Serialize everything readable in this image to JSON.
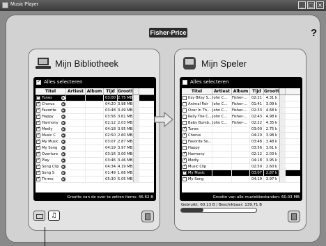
{
  "window": {
    "title": "Music Player",
    "buttons": [
      "_",
      "□",
      "×"
    ]
  },
  "logo": "Fisher-Price",
  "help": "?",
  "library": {
    "title": "Mijn Bibliotheek",
    "select_all": "Alles selecteren",
    "select_all_checked": true,
    "columns": [
      "Titel",
      "Artiest",
      "Album",
      "Tijd",
      "Grootte"
    ],
    "rows": [
      {
        "title": "Tunes",
        "artist": "",
        "album": "",
        "time": "03:00",
        "size": "2.75 MB",
        "checked": true,
        "selected": true
      },
      {
        "title": "Chorus",
        "artist": "",
        "album": "",
        "time": "04:20",
        "size": "3.98 MB",
        "checked": true
      },
      {
        "title": "Favorite",
        "artist": "",
        "album": "",
        "time": "03:48",
        "size": "3.49 MB",
        "checked": true
      },
      {
        "title": "Happy",
        "artist": "",
        "album": "",
        "time": "03:56",
        "size": "3.61 MB",
        "checked": true
      },
      {
        "title": "Harmony",
        "artist": "",
        "album": "",
        "time": "02:12",
        "size": "2.03 MB",
        "checked": true
      },
      {
        "title": "Medly",
        "artist": "",
        "album": "",
        "time": "04:18",
        "size": "3.95 MB",
        "checked": true
      },
      {
        "title": "Music C",
        "artist": "",
        "album": "",
        "time": "02:50",
        "size": "2.60 MB",
        "checked": true
      },
      {
        "title": "My Music",
        "artist": "",
        "album": "",
        "time": "03:07",
        "size": "2.87 MB",
        "checked": true
      },
      {
        "title": "My Song",
        "artist": "",
        "album": "",
        "time": "04:19",
        "size": "3.97 MB",
        "checked": true
      },
      {
        "title": "Overture",
        "artist": "",
        "album": "",
        "time": "03:16",
        "size": "3.00 MB",
        "checked": true
      },
      {
        "title": "Play",
        "artist": "",
        "album": "",
        "time": "03:46",
        "size": "3.46 MB",
        "checked": true
      },
      {
        "title": "Song Clip",
        "artist": "",
        "album": "",
        "time": "04:34",
        "size": "4.19 MB",
        "checked": true
      },
      {
        "title": "Song S",
        "artist": "",
        "album": "",
        "time": "01:49",
        "size": "1.68 MB",
        "checked": true
      },
      {
        "title": "Thrmo",
        "artist": "",
        "album": "",
        "time": "05:30",
        "size": "5.05 MB",
        "checked": true
      }
    ],
    "footer": "Grootte van de over te zetten items: 46.62 B"
  },
  "player": {
    "title": "Mijn Speler",
    "select_all": "Alles selecteren",
    "select_all_checked": false,
    "columns": [
      "Titel",
      "Artiest",
      "Album",
      "Tijd",
      "Grootte"
    ],
    "rows": [
      {
        "title": "Itsy Bitsy S...",
        "artist": "John C...",
        "album": "Fisher-...",
        "time": "02:21",
        "size": "4.31 k",
        "checked": false
      },
      {
        "title": "Animal Fair",
        "artist": "John C...",
        "album": "Fisher-...",
        "time": "01:41",
        "size": "3.09 k",
        "checked": false
      },
      {
        "title": "Over In Th...",
        "artist": "John C...",
        "album": "Fisher-...",
        "time": "02:33",
        "size": "4.68 k",
        "checked": false
      },
      {
        "title": "Kelly The C...",
        "artist": "John C...",
        "album": "Fisher-...",
        "time": "02:43",
        "size": "4.98 k",
        "checked": false
      },
      {
        "title": "Baby Bumb...",
        "artist": "John C...",
        "album": "Fisher-...",
        "time": "02:22",
        "size": "4.35 k",
        "checked": false
      },
      {
        "title": "Tunes",
        "artist": "",
        "album": "",
        "time": "03:00",
        "size": "2.75 k",
        "checked": true
      },
      {
        "title": "Chorus",
        "artist": "",
        "album": "",
        "time": "04:20",
        "size": "3.98 k",
        "checked": true
      },
      {
        "title": "Favorite So...",
        "artist": "",
        "album": "",
        "time": "03:48",
        "size": "3.48 k",
        "checked": false
      },
      {
        "title": "Happy",
        "artist": "",
        "album": "",
        "time": "03:56",
        "size": "3.61 k",
        "checked": false
      },
      {
        "title": "Harmony",
        "artist": "",
        "album": "",
        "time": "02:12",
        "size": "2.03 k",
        "checked": true
      },
      {
        "title": "Medly",
        "artist": "",
        "album": "",
        "time": "04:18",
        "size": "3.95 k",
        "checked": true
      },
      {
        "title": "Music Clip",
        "artist": "",
        "album": "",
        "time": "02:50",
        "size": "2.60 k",
        "checked": true
      },
      {
        "title": "My Music",
        "artist": "",
        "album": "",
        "time": "03:07",
        "size": "2.87 k",
        "checked": true,
        "selected": true
      },
      {
        "title": "My Song",
        "artist": "",
        "album": "",
        "time": "04:19",
        "size": "3.97 k",
        "checked": false
      }
    ],
    "footer": "Grootte van alle muziekbestanden: 60.03 MB",
    "storage_text": "Gebruikt: 60.13 B / Beschikbaar: 139.71 B",
    "storage_fraction": 0.3
  }
}
